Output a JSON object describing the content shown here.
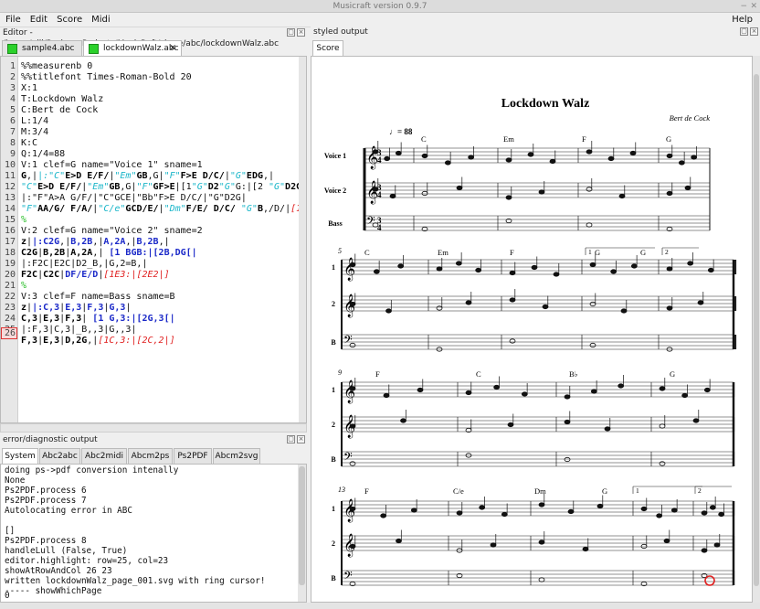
{
  "window": {
    "title": "Musicraft version 0.9.7"
  },
  "menu": {
    "items": [
      "File",
      "Edit",
      "Score",
      "Midi"
    ],
    "help": "Help"
  },
  "editor_panel": {
    "title": "Editor - /home/gill/PycharmProjects/MusicRaft/share/abc/lockdownWalz.abc",
    "tabs": [
      {
        "label": "sample4.abc"
      },
      {
        "label": "lockdownWalz.abc"
      }
    ],
    "current_line": "26"
  },
  "error_panel": {
    "title": "error/diagnostic output",
    "tabs": [
      "System",
      "Abc2abc",
      "Abc2midi",
      "Abcm2ps",
      "Ps2PDF",
      "Abcm2svg"
    ],
    "lines": [
      "doing ps->pdf conversion intenally",
      "None",
      "Ps2PDF.process 6",
      "Ps2PDF.process 7",
      "Autolocating error in ABC",
      "",
      "[]",
      "Ps2PDF.process 8",
      "handleLull (False, True)",
      "editor.highlight: row=25, col=23",
      "showAtRowAndCol 26 23",
      "written lockdownWalz_page_001.svg with ring cursor!",
      "----- showWhichPage",
      "",
      "0"
    ]
  },
  "output_panel": {
    "title": "styled output",
    "tab": "Score"
  },
  "score": {
    "title": "Lockdown Walz",
    "composer": "Bert de Cock",
    "tempo": "= 88",
    "voice_labels": [
      "Voice 1",
      "Voice 2",
      "Bass"
    ],
    "short_labels": [
      "1",
      "2",
      "B"
    ],
    "system1_chords": [
      "C",
      "Em",
      "F",
      "G"
    ],
    "system2_chords": [
      "C",
      "Em",
      "F",
      "G",
      "G"
    ],
    "system3_chords": [
      "F",
      "C",
      "B♭",
      "G"
    ],
    "system4_chords": [
      "F",
      "C/e",
      "Dm",
      "G"
    ],
    "measure_numbers": [
      "5",
      "9",
      "13"
    ],
    "endings": [
      "1",
      "2"
    ]
  }
}
